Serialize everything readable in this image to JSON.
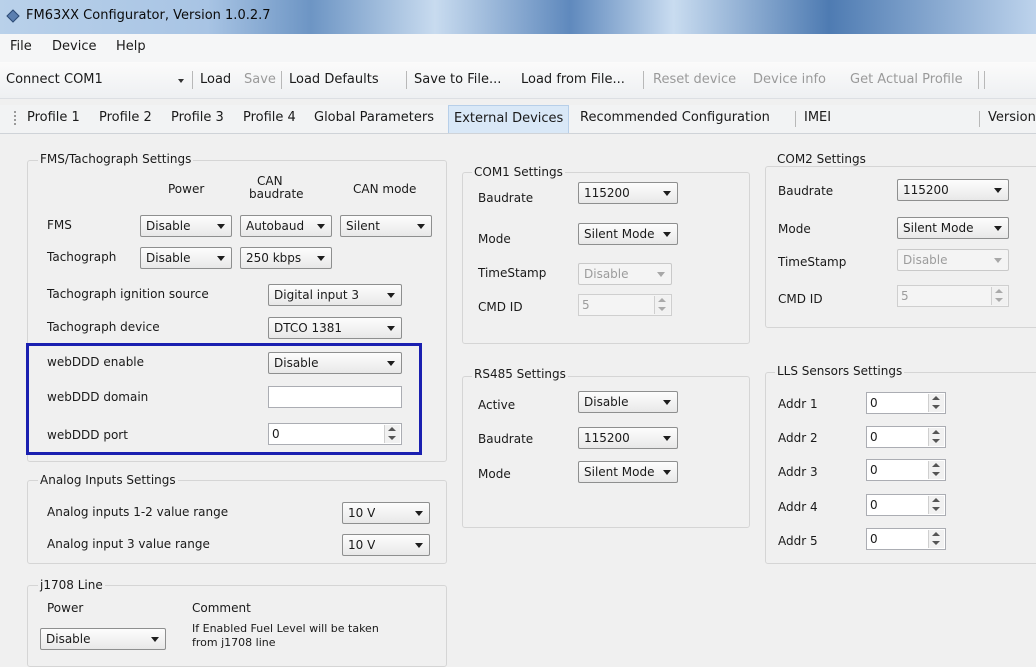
{
  "window": {
    "title": "FM63XX Configurator, Version 1.0.2.7"
  },
  "menu": [
    "File",
    "Device",
    "Help"
  ],
  "toolbar": {
    "connect_label": "Connect",
    "port": "COM1",
    "load": "Load",
    "save": "Save",
    "load_defaults": "Load Defaults",
    "save_to_file": "Save to File...",
    "load_from_file": "Load from File...",
    "reset_device": "Reset device",
    "device_info": "Device info",
    "get_actual_profile": "Get Actual Profile"
  },
  "tabs": [
    "Profile 1",
    "Profile 2",
    "Profile 3",
    "Profile 4",
    "Global Parameters",
    "External Devices",
    "Recommended Configuration",
    "IMEI",
    "Version"
  ],
  "active_tab": "External Devices",
  "fms": {
    "title": "FMS/Tachograph Settings",
    "col_power": "Power",
    "col_can_baud_1": "CAN",
    "col_can_baud_2": "baudrate",
    "col_can_mode": "CAN mode",
    "fms_label": "FMS",
    "fms_power": "Disable",
    "fms_baud": "Autobaud",
    "fms_mode": "Silent",
    "tacho_label": "Tachograph",
    "tacho_power": "Disable",
    "tacho_baud": "250 kbps",
    "ign_label": "Tachograph ignition source",
    "ign_value": "Digital input 3",
    "device_label": "Tachograph device",
    "device_value": "DTCO 1381",
    "webddd_enable_label": "webDDD enable",
    "webddd_enable_value": "Disable",
    "webddd_domain_label": "webDDD domain",
    "webddd_domain_value": "",
    "webddd_port_label": "webDDD port",
    "webddd_port_value": "0"
  },
  "analog": {
    "title": "Analog Inputs Settings",
    "range12_label": "Analog inputs 1-2 value range",
    "range12_value": "10 V",
    "range3_label": "Analog input 3 value range",
    "range3_value": "10 V"
  },
  "j1708": {
    "title": "j1708 Line",
    "power_label": "Power",
    "power_value": "Disable",
    "comment_label": "Comment",
    "comment_line1": "If Enabled Fuel Level will be taken",
    "comment_line2": "from j1708 line"
  },
  "com1": {
    "title": "COM1 Settings",
    "baud_label": "Baudrate",
    "baud_value": "115200",
    "mode_label": "Mode",
    "mode_value": "Silent Modе",
    "ts_label": "TimeStamp",
    "ts_value": "Disable",
    "cmd_label": "CMD ID",
    "cmd_value": "5"
  },
  "com2": {
    "title": "COM2 Settings",
    "baud_label": "Baudrate",
    "baud_value": "115200",
    "mode_label": "Mode",
    "mode_value": "Silent Mode",
    "ts_label": "TimeStamp",
    "ts_value": "Disable",
    "cmd_label": "CMD ID",
    "cmd_value": "5"
  },
  "rs485": {
    "title": "RS485 Settings",
    "active_label": "Active",
    "active_value": "Disable",
    "baud_label": "Baudrate",
    "baud_value": "115200",
    "mode_label": "Mode",
    "mode_value": "Silent Modе"
  },
  "lls": {
    "title": "LLS Sensors Settings",
    "addrs": [
      {
        "label": "Addr 1",
        "value": "0"
      },
      {
        "label": "Addr 2",
        "value": "0"
      },
      {
        "label": "Addr 3",
        "value": "0"
      },
      {
        "label": "Addr 4",
        "value": "0"
      },
      {
        "label": "Addr 5",
        "value": "0"
      }
    ]
  },
  "colors": {
    "highlight": "#1a1fb0",
    "active_tab": "#d9e8f7"
  }
}
